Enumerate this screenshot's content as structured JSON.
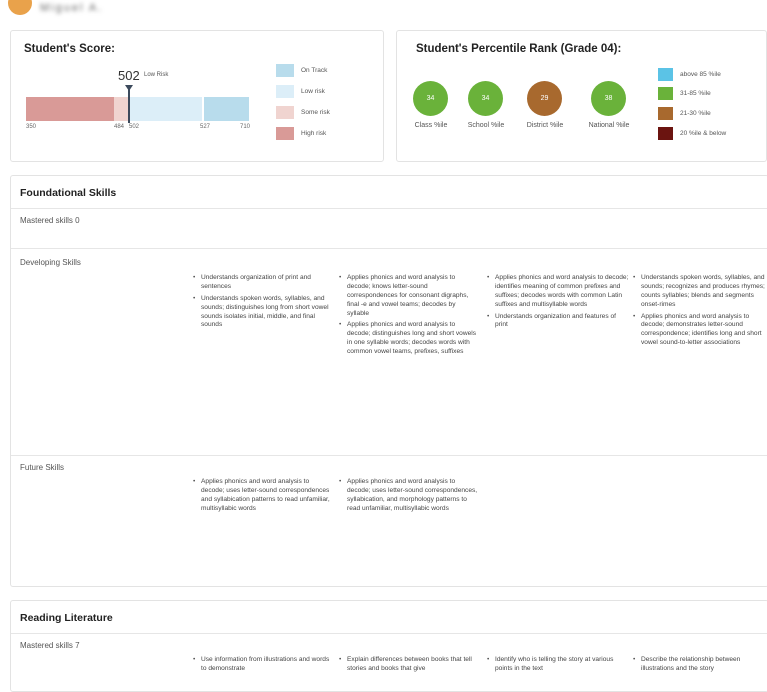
{
  "header": {
    "name": "Miguel A."
  },
  "score_card": {
    "title": "Student's Score:",
    "score": "502",
    "score_label": "Low Risk",
    "ticks": [
      "350",
      "484",
      "502",
      "527",
      "710"
    ],
    "legend": [
      {
        "label": "On Track",
        "color": "#b8dcec"
      },
      {
        "label": "Low risk",
        "color": "#dceef8"
      },
      {
        "label": "Some risk",
        "color": "#f0d4d0"
      },
      {
        "label": "High risk",
        "color": "#d99a97"
      }
    ]
  },
  "percentile_card": {
    "title": "Student's Percentile Rank (Grade 04):",
    "circles": [
      {
        "value": "34",
        "label": "Class %ile",
        "color": "#6ab23a"
      },
      {
        "value": "34",
        "label": "School %ile",
        "color": "#6ab23a"
      },
      {
        "value": "29",
        "label": "District %ile",
        "color": "#a8692e"
      },
      {
        "value": "38",
        "label": "National %ile",
        "color": "#6ab23a"
      }
    ],
    "legend": [
      {
        "label": "above 85 %ile",
        "color": "#5bc3e6"
      },
      {
        "label": "31-85 %ile",
        "color": "#6ab23a"
      },
      {
        "label": "21-30 %ile",
        "color": "#a8692e"
      },
      {
        "label": "20 %ile & below",
        "color": "#6b1410"
      }
    ]
  },
  "foundational": {
    "title": "Foundational Skills",
    "mastered": "Mastered skills 0",
    "developing_label": "Developing Skills",
    "developing": [
      [
        "Understands organization of print and sentences",
        "Understands spoken words, syllables, and sounds; distinguishes long from short vowel sounds isolates initial, middle, and final sounds"
      ],
      [
        "Applies phonics and word analysis to decode; knows letter-sound correspondences for consonant digraphs, final -e and vowel teams; decodes by syllable",
        "Applies phonics and word analysis to decode; distinguishes long and short vowels in one syllable words; decodes words with common vowel teams, prefixes, suffixes"
      ],
      [
        "Applies phonics and word analysis to decode; identifies meaning of common prefixes and suffixes; decodes words with common Latin suffixes and multisyllable words",
        "Understands organization and features of print"
      ],
      [
        "Understands spoken words, syllables, and sounds; recognizes and produces rhymes; counts syllables; blends and segments onset-rimes",
        "Applies phonics and word analysis to decode; demonstrates letter-sound correspondence; identifies long and short vowel sound-to-letter associations"
      ]
    ],
    "future_label": "Future Skills",
    "future": [
      [
        "Applies phonics and word analysis to decode; uses letter-sound correspondences and syllabication patterns to read unfamiliar, multisyllabic words"
      ],
      [
        "Applies phonics and word analysis to decode; uses letter-sound correspondences, syllabication, and morphology patterns to read unfamiliar, multisyllabic words"
      ]
    ]
  },
  "reading": {
    "title": "Reading Literature",
    "mastered": "Mastered skills 7",
    "items": [
      [
        "Use information from illustrations and words to demonstrate"
      ],
      [
        "Explain differences between books that tell stories and books that give"
      ],
      [
        "Identify who is telling the story at various points in the text"
      ],
      [
        "Describe the relationship between illustrations and the story"
      ]
    ]
  }
}
